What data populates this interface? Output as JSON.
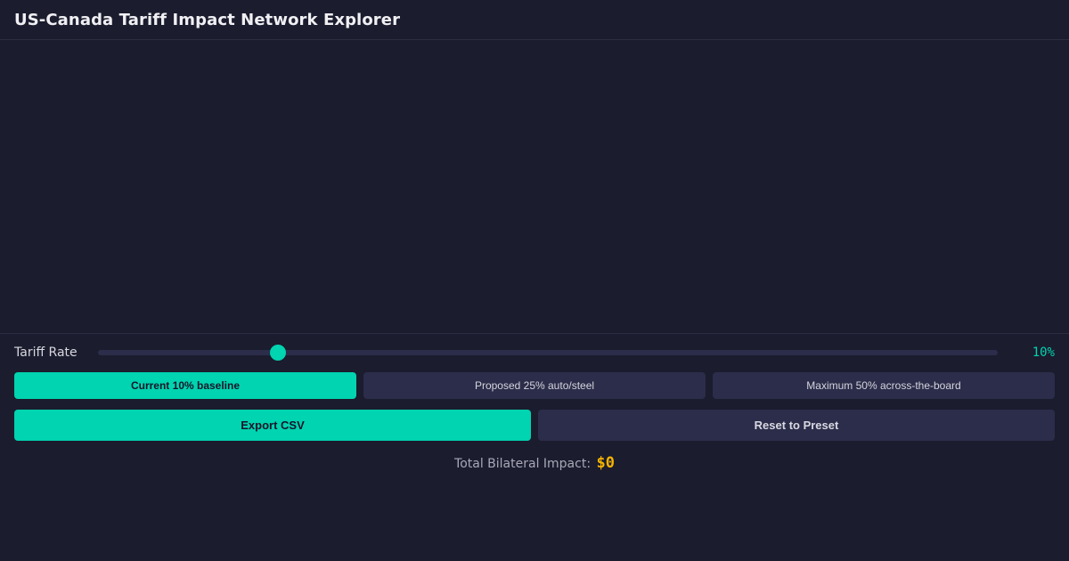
{
  "app": {
    "title": "US-Canada Tariff Impact Network Explorer"
  },
  "slider": {
    "label": "Tariff Rate",
    "value_text": "10%",
    "value": 10,
    "min": 0,
    "max": 50
  },
  "presets": [
    {
      "label": "Current 10% baseline",
      "active": true
    },
    {
      "label": "Proposed 25% auto/steel",
      "active": false
    },
    {
      "label": "Maximum 50% across-the-board",
      "active": false
    }
  ],
  "actions": {
    "export_label": "Export CSV",
    "reset_label": "Reset to Preset"
  },
  "summary": {
    "label": "Total Bilateral Impact:",
    "value": "$0"
  },
  "colors": {
    "background": "#1b1c2e",
    "accent": "#00d4b0",
    "highlight": "#f5b400",
    "surface": "#2c2d4a"
  }
}
